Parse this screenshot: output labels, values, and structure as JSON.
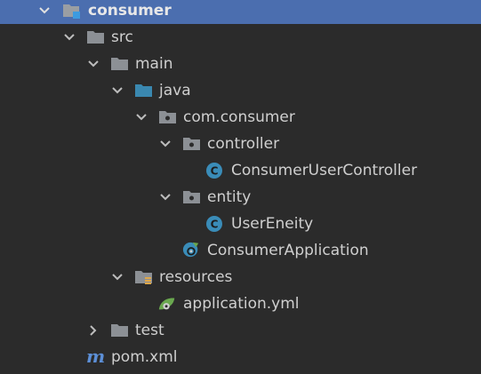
{
  "colors": {
    "background": "#2b2b2b",
    "selection": "#4b6eaf",
    "folder": "#8c9095",
    "source_folder": "#3a88b0",
    "class_badge": "#3a8cb8",
    "spring_green": "#6aa84f",
    "maven": "#5c8fd6"
  },
  "tree": {
    "consumer": {
      "label": "consumer",
      "icon": "module-folder-icon",
      "expanded": true
    },
    "src": {
      "label": "src",
      "icon": "folder-icon",
      "expanded": true
    },
    "main": {
      "label": "main",
      "icon": "folder-icon",
      "expanded": true
    },
    "java": {
      "label": "java",
      "icon": "source-folder-icon",
      "expanded": true
    },
    "package": {
      "label": "com.consumer",
      "icon": "package-icon",
      "expanded": true
    },
    "controller": {
      "label": "controller",
      "icon": "package-icon",
      "expanded": true
    },
    "controller_class": {
      "label": "ConsumerUserController",
      "icon": "class-icon",
      "badge": "C"
    },
    "entity": {
      "label": "entity",
      "icon": "package-icon",
      "expanded": true
    },
    "entity_class": {
      "label": "UserEneity",
      "icon": "class-icon",
      "badge": "C"
    },
    "app_class": {
      "label": "ConsumerApplication",
      "icon": "spring-boot-class-icon"
    },
    "resources": {
      "label": "resources",
      "icon": "resources-folder-icon",
      "expanded": true
    },
    "app_yml": {
      "label": "application.yml",
      "icon": "spring-config-icon"
    },
    "test": {
      "label": "test",
      "icon": "folder-icon",
      "expanded": false
    },
    "pom": {
      "label": "pom.xml",
      "icon": "maven-icon",
      "glyph": "m"
    }
  }
}
